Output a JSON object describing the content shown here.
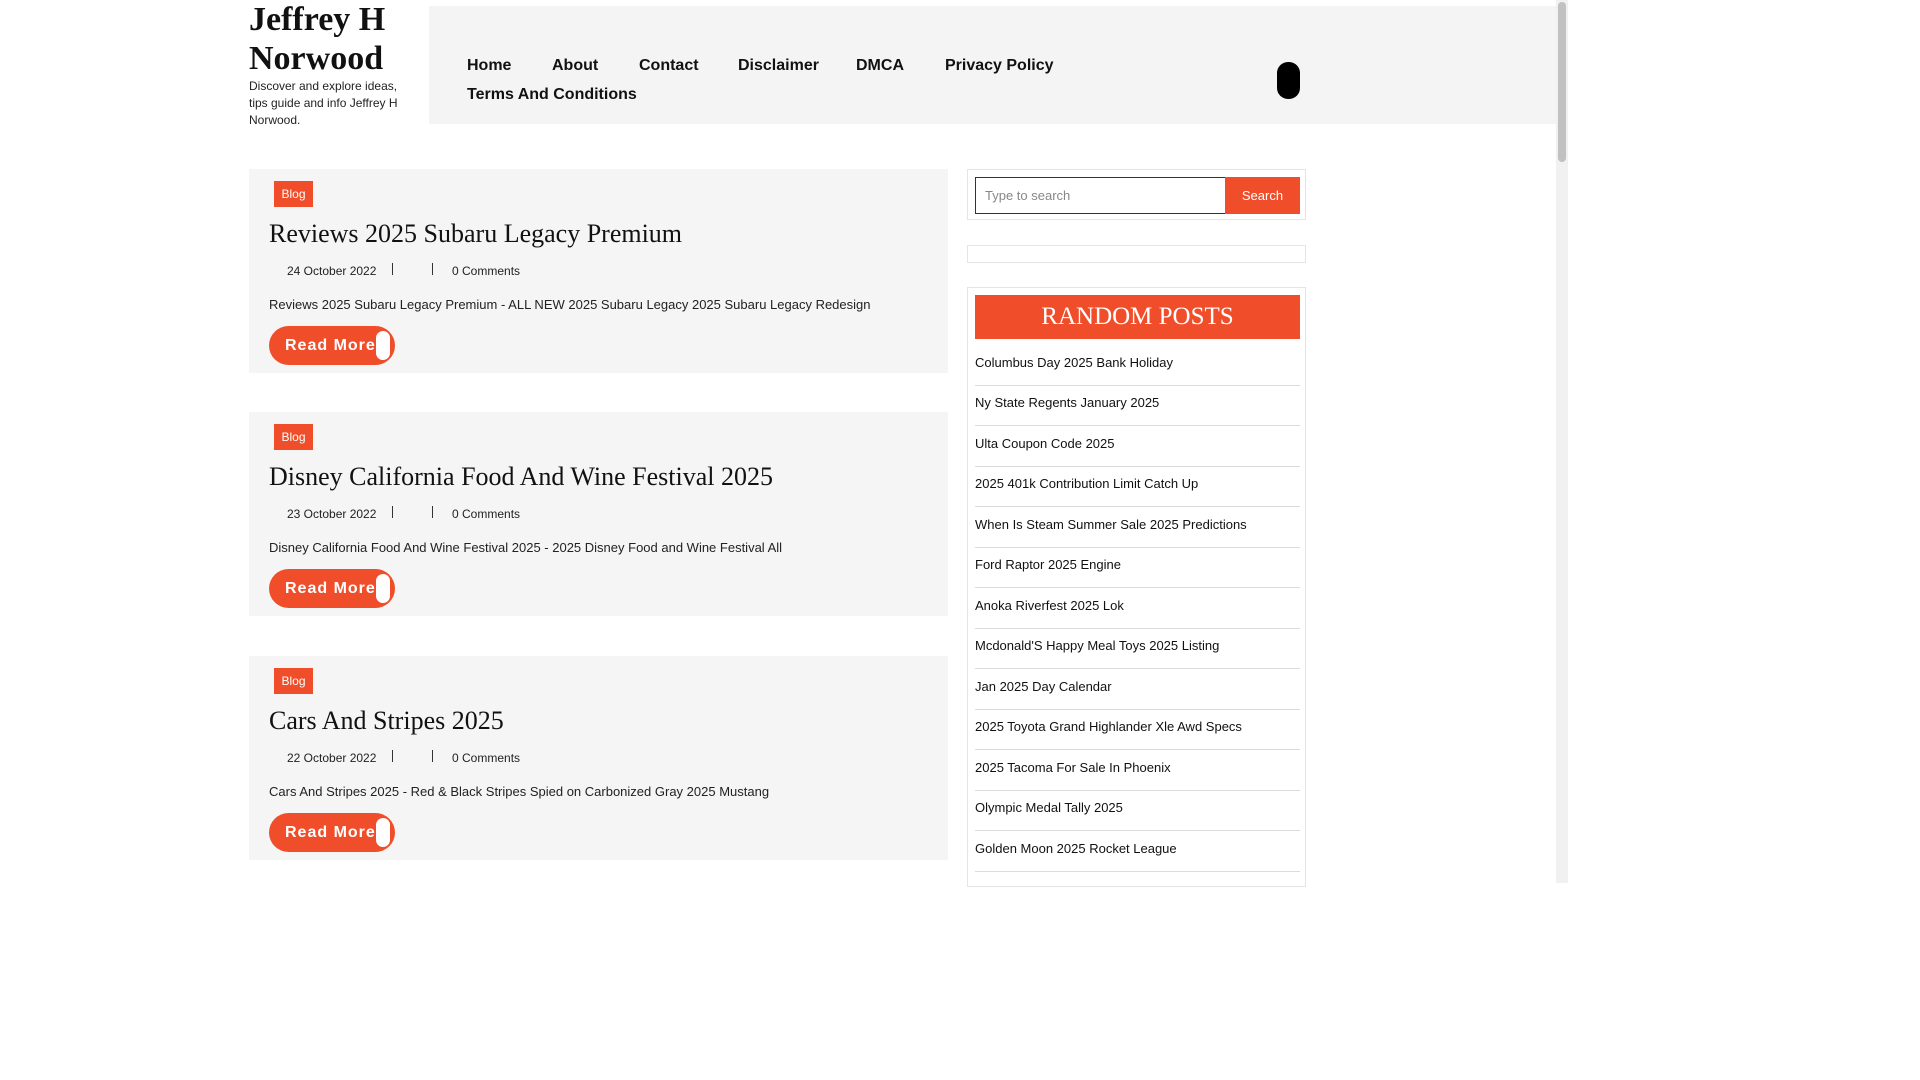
{
  "site": {
    "title": "Jeffrey H Norwood",
    "tagline": "Discover and explore ideas, tips guide and info Jeffrey H Norwood."
  },
  "nav": {
    "items": [
      "Home",
      "About",
      "Contact",
      "Disclaimer",
      "DMCA",
      "Privacy Policy",
      "Terms And Conditions"
    ]
  },
  "posts": [
    {
      "category": "Blog",
      "title": "Reviews 2025 Subaru Legacy Premium",
      "date": "24 October 2022",
      "comments": "0 Comments",
      "excerpt": "Reviews 2025 Subaru Legacy Premium - ALL NEW 2025 Subaru Legacy 2025 Subaru Legacy Redesign",
      "read_more": "Read More"
    },
    {
      "category": "Blog",
      "title": "Disney California Food And Wine Festival 2025",
      "date": "23 October 2022",
      "comments": "0 Comments",
      "excerpt": "Disney California Food And Wine Festival 2025 - 2025 Disney Food and Wine Festival All",
      "read_more": "Read More"
    },
    {
      "category": "Blog",
      "title": "Cars And Stripes 2025",
      "date": "22 October 2022",
      "comments": "0 Comments",
      "excerpt": "Cars And Stripes 2025 - Red & Black Stripes Spied on Carbonized Gray 2025 Mustang",
      "read_more": "Read More"
    }
  ],
  "sidebar": {
    "search": {
      "placeholder": "Type to search",
      "button_label": "Search"
    },
    "random_posts": {
      "heading": "RANDOM POSTS",
      "items": [
        "Columbus Day 2025 Bank Holiday",
        "Ny State Regents January 2025",
        "Ulta Coupon Code 2025",
        "2025 401k Contribution Limit Catch Up",
        "When Is Steam Summer Sale 2025 Predictions",
        "Ford Raptor 2025 Engine",
        "Anoka Riverfest 2025 Lok",
        "Mcdonald'S Happy Meal Toys 2025 Listing",
        "Jan 2025 Day Calendar",
        "2025 Toyota Grand Highlander Xle Awd Specs",
        "2025 Tacoma For Sale In Phoenix",
        "Olympic Medal Tally 2025",
        "Golden Moon 2025 Rocket League"
      ]
    }
  },
  "colors": {
    "accent": "#f04e2a",
    "card_background": "#f5f5f5",
    "nav_background": "#f4f4f4"
  }
}
